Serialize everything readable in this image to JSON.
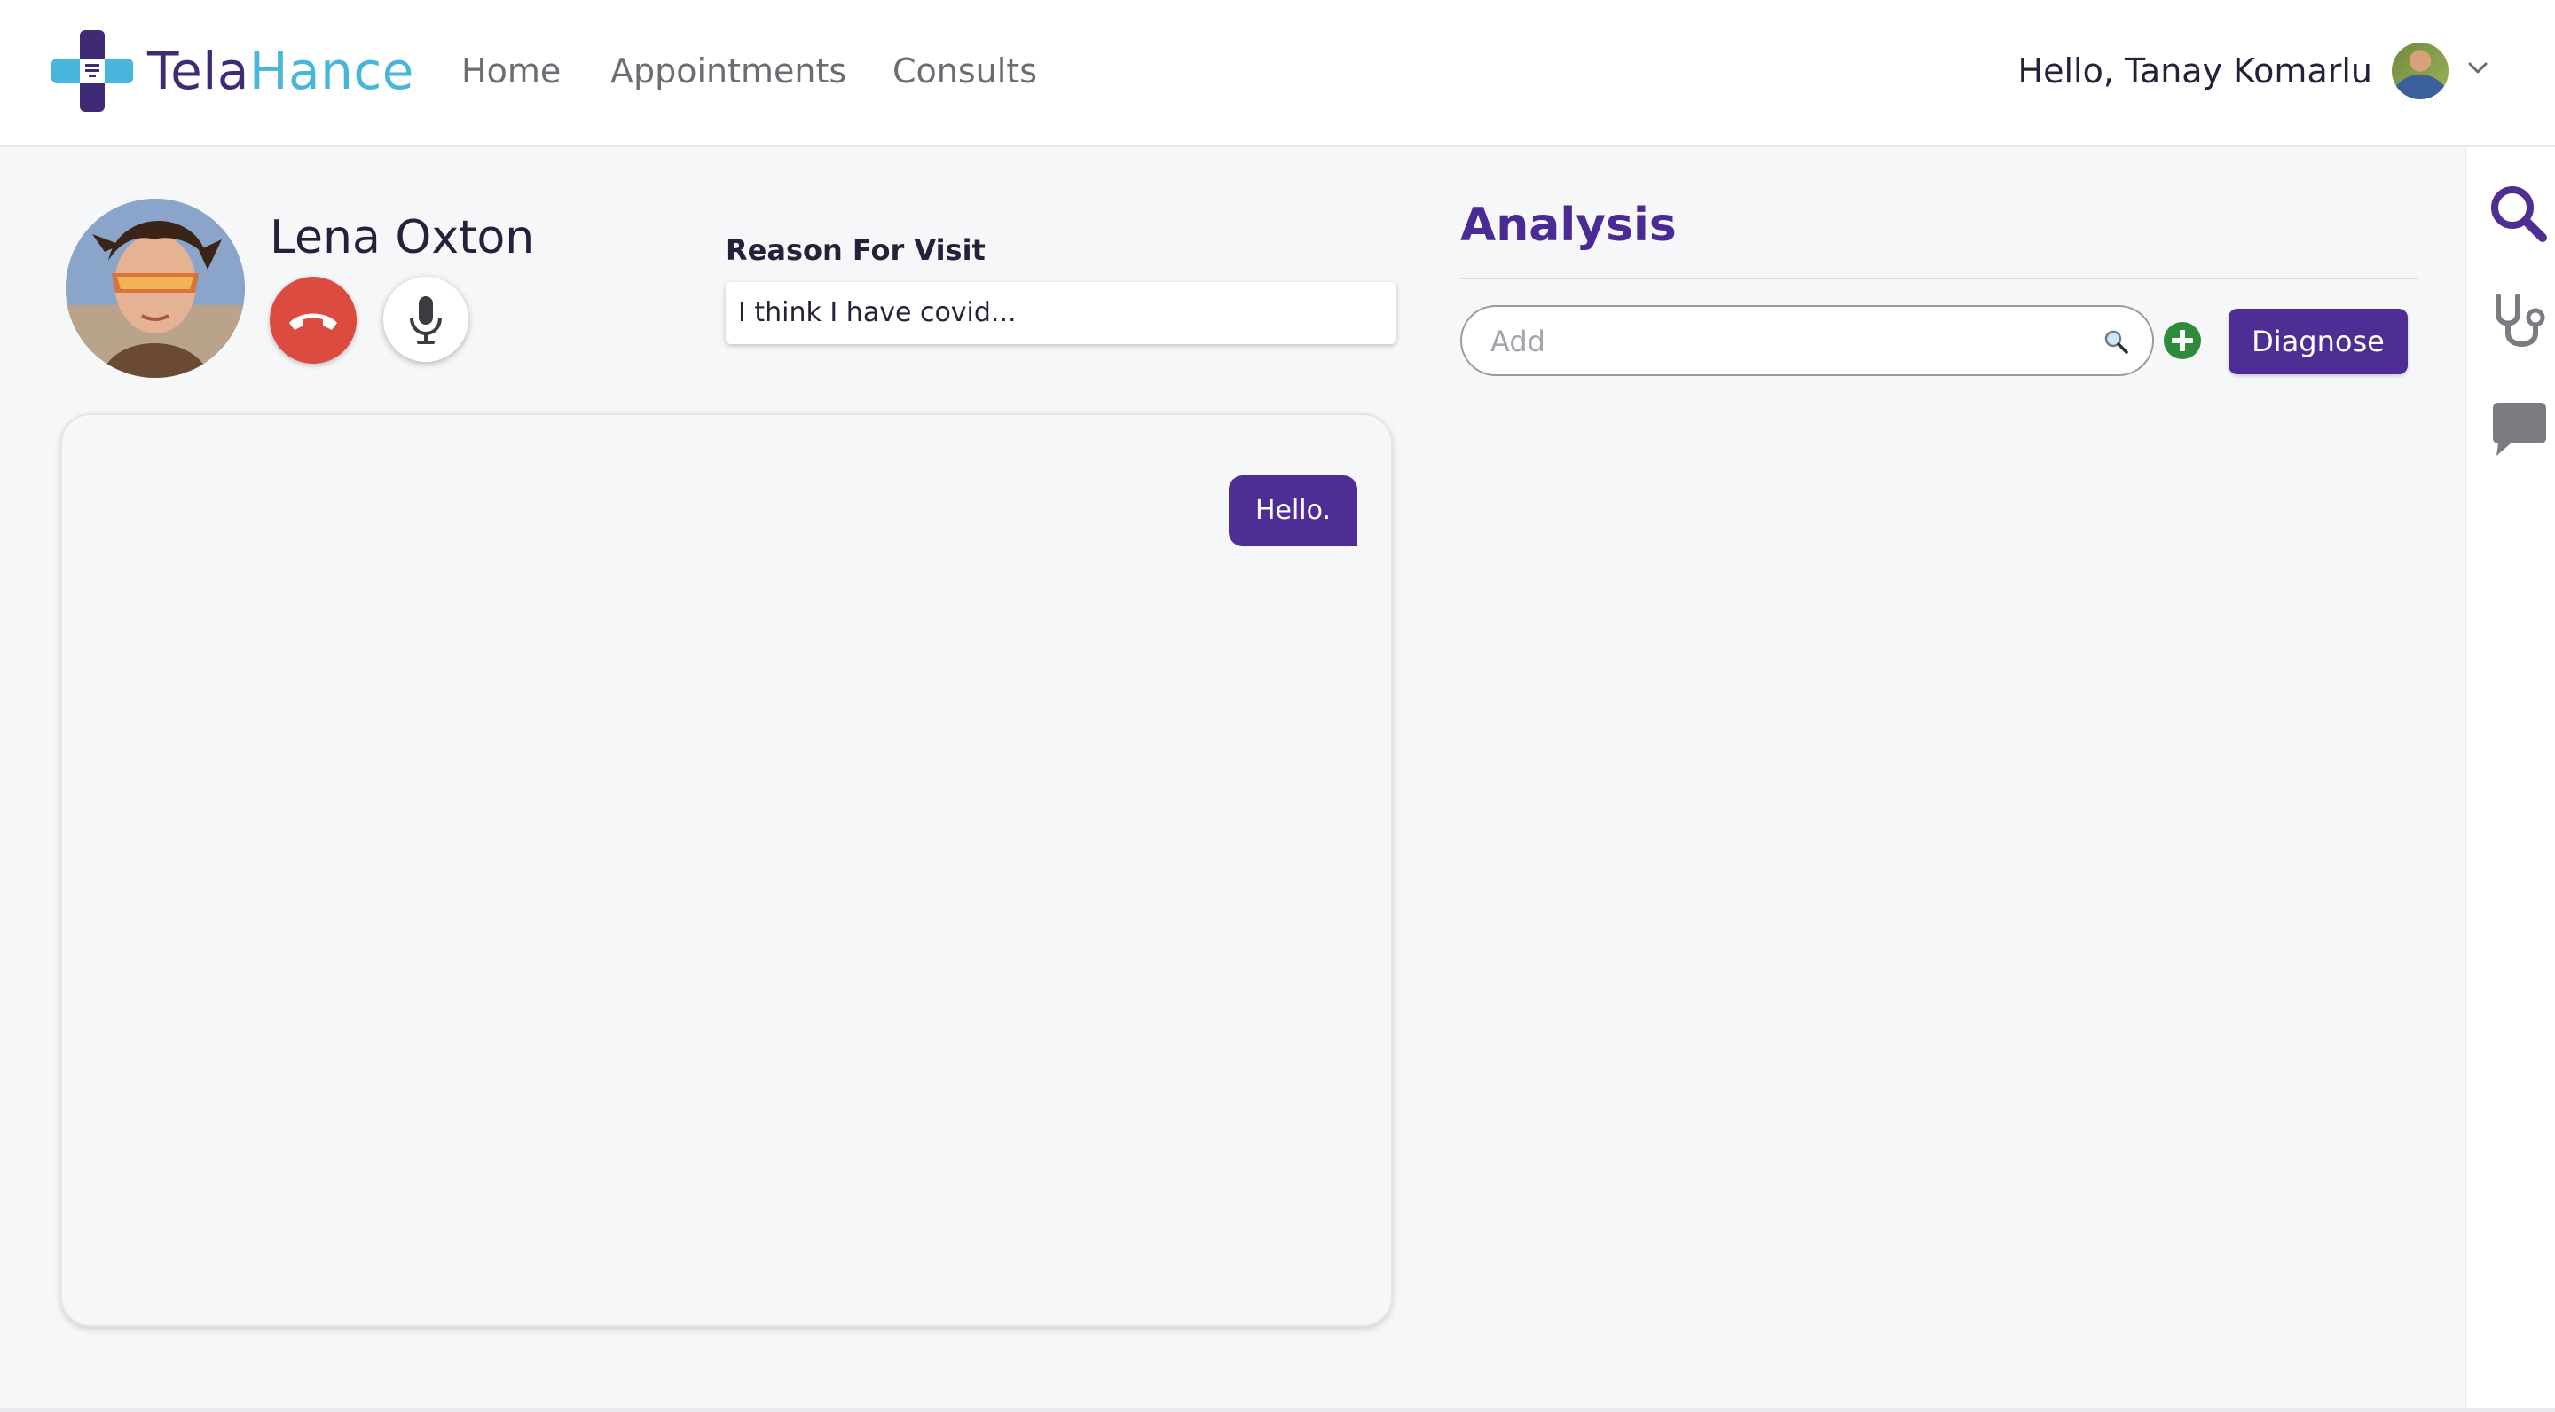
{
  "brand": {
    "name_part1": "Tela",
    "name_part2": "Hance",
    "colors": {
      "primary": "#3f2a75",
      "secondary": "#48b6da"
    }
  },
  "nav": {
    "items": [
      {
        "label": "Home"
      },
      {
        "label": "Appointments"
      },
      {
        "label": "Consults"
      }
    ]
  },
  "user": {
    "greeting": "Hello, Tanay Komarlu",
    "avatar_icon": "user-avatar",
    "menu_icon": "chevron-down-icon"
  },
  "patient": {
    "name": "Lena Oxton",
    "photo_icon": "patient-avatar",
    "controls": {
      "end_call_icon": "phone-hangup-icon",
      "mic_icon": "microphone-icon"
    }
  },
  "visit": {
    "label": "Reason For Visit",
    "reason": "I think I have covid..."
  },
  "chat": {
    "messages": [
      {
        "text": "Hello.",
        "from": "self"
      }
    ]
  },
  "analysis": {
    "title": "Analysis",
    "search": {
      "placeholder": "Add",
      "value": ""
    },
    "add_icon": "plus-circle-icon",
    "diagnose_label": "Diagnose"
  },
  "sidebar": {
    "icons": [
      "search-icon",
      "stethoscope-icon",
      "chat-bubble-icon"
    ]
  },
  "colors": {
    "accent": "#4e2d94",
    "danger": "#dc4b40",
    "success": "#2e8b3a"
  }
}
